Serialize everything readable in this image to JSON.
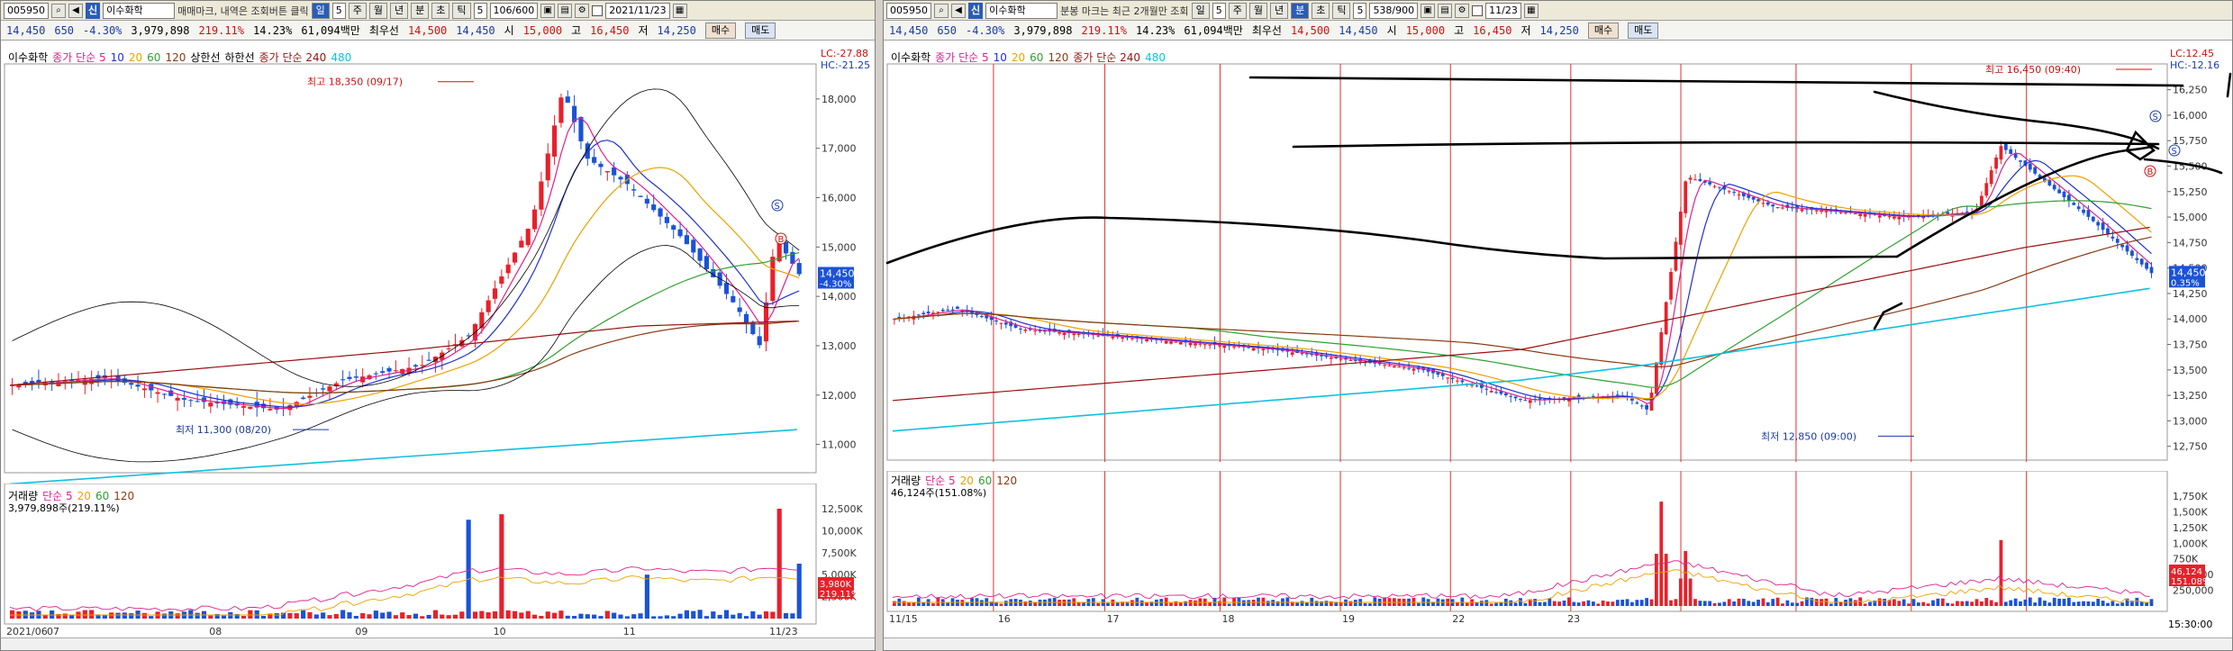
{
  "left": {
    "code": "005950",
    "stock_name": "이수화학",
    "shin": "신",
    "hint": "매매마크, 내역은 조회버튼 클릭",
    "period_buttons": [
      "일",
      "주",
      "월",
      "년",
      "분",
      "초",
      "틱"
    ],
    "active_period": "일",
    "period_num": "5",
    "interval": "5",
    "count": "106/600",
    "date": "2021/11/23",
    "buy": "매수",
    "sell": "매도",
    "quote": {
      "price": "14,450",
      "change": "650",
      "pct": "-4.30%",
      "volume": "3,979,898",
      "vol_ratio": "219.11%",
      "turnover": "14.23%",
      "amount": "61,094백만",
      "best_ask_label": "최우선",
      "best_ask": "14,500",
      "best_bid": "14,450",
      "open_label": "시",
      "open": "15,000",
      "high_label": "고",
      "high": "16,450",
      "low_label": "저",
      "low": "14,250"
    },
    "legend_price": [
      "이수화학",
      "종가 단순 5",
      "10",
      "20",
      "60",
      "120",
      "상한선",
      "하한선",
      "종가 단순 240",
      "480"
    ],
    "lc": "LC:-27.88",
    "hc": "HC:-21.25",
    "high_anno": "최고 18,350 (09/17)",
    "low_anno": "최저 11,300 (08/20)",
    "y_ticks": [
      "18,000",
      "17,000",
      "16,000",
      "15,000",
      "14,000",
      "13,000",
      "12,000",
      "11,000"
    ],
    "last_price_box": [
      "14,450",
      "-4.30%"
    ],
    "legend_vol": [
      "거래량",
      "단순 5",
      "20",
      "60",
      "120"
    ],
    "vol_text": "3,979,898주(219.11%)",
    "vol_ticks": [
      "12,500K",
      "10,000K",
      "7,500K",
      "5,000K",
      "2,500K"
    ],
    "vol_box": [
      "3,980K",
      "219.11%"
    ],
    "x_ticks": [
      "2021/06",
      "07",
      "08",
      "09",
      "10",
      "11",
      "11/23"
    ],
    "markers": [
      "S",
      "B"
    ]
  },
  "right": {
    "code": "005950",
    "stock_name": "이수화학",
    "shin": "신",
    "hint": "분봉 마크는 최근 2개월만 조회",
    "period_buttons": [
      "일",
      "주",
      "월",
      "년",
      "분",
      "초",
      "틱"
    ],
    "active_period": "분",
    "period_num": "5",
    "interval": "5",
    "count": "538/900",
    "date": "11/23",
    "buy": "매수",
    "sell": "매도",
    "legend_price": [
      "이수화학",
      "종가 단순 5",
      "10",
      "20",
      "60",
      "120",
      "종가 단순 240",
      "480"
    ],
    "lc": "LC:12.45",
    "hc": "HC:-12.16",
    "high_anno": "최고 16,450 (09:40)",
    "low_anno": "최저 12,850 (09:00)",
    "y_ticks": [
      "16,250",
      "16,000",
      "15,750",
      "15,500",
      "15,250",
      "15,000",
      "14,750",
      "14,500",
      "14,250",
      "14,000",
      "13,750",
      "13,500",
      "13,250",
      "13,000",
      "12,750"
    ],
    "last_price_box": [
      "14,450",
      "0.35%"
    ],
    "legend_vol": [
      "거래량",
      "단순 5",
      "20",
      "60",
      "120"
    ],
    "vol_text": "46,124주(151.08%)",
    "vol_ticks": [
      "1,750K",
      "1,500K",
      "1,250K",
      "1,000K",
      "750K",
      "500,000",
      "250,000"
    ],
    "vol_box": [
      "46,124",
      "151.08%"
    ],
    "x_ticks": [
      "11/15",
      "16",
      "17",
      "18",
      "19",
      "22",
      "23"
    ],
    "time_label": "15:30:00",
    "markers": [
      "S",
      "S",
      "B"
    ]
  },
  "colors": {
    "up": "#e8202a",
    "down": "#1a52d8",
    "ma5": "#e0208c",
    "ma10": "#2030d0",
    "ma20": "#f0a000",
    "ma60": "#30a030",
    "ma120": "#8a3a10",
    "ma240": "#9a1010",
    "ma480": "#10c0e0"
  }
}
